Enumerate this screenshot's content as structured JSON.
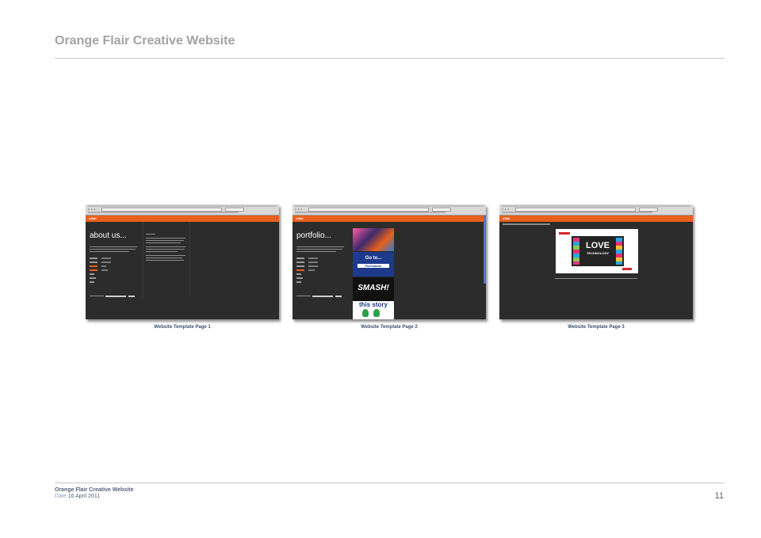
{
  "document": {
    "title": "Orange Flair Creative Website"
  },
  "thumbnails": [
    {
      "caption": "Website Template Page 1",
      "heading": "about us...",
      "logo": "oflair"
    },
    {
      "caption": "Website Template Page 2",
      "heading": "portfolio...",
      "logo": "oflair",
      "tiles": [
        "Go to...",
        "Portmaster",
        "SMASH!",
        "this story"
      ]
    },
    {
      "caption": "Website Template Page 3",
      "logo": "oflair",
      "feature_title": "LOVE",
      "feature_subtitle": "TECHNOLOGY"
    }
  ],
  "footer": {
    "title": "Orange Flair Creative Website",
    "date_label": "Date",
    "date_value": "16 April 2011",
    "page_number": "11"
  },
  "colors": {
    "site_accent": "#e8601c",
    "title_grey": "#a3a3a3",
    "caption_blue": "#3f5170"
  }
}
